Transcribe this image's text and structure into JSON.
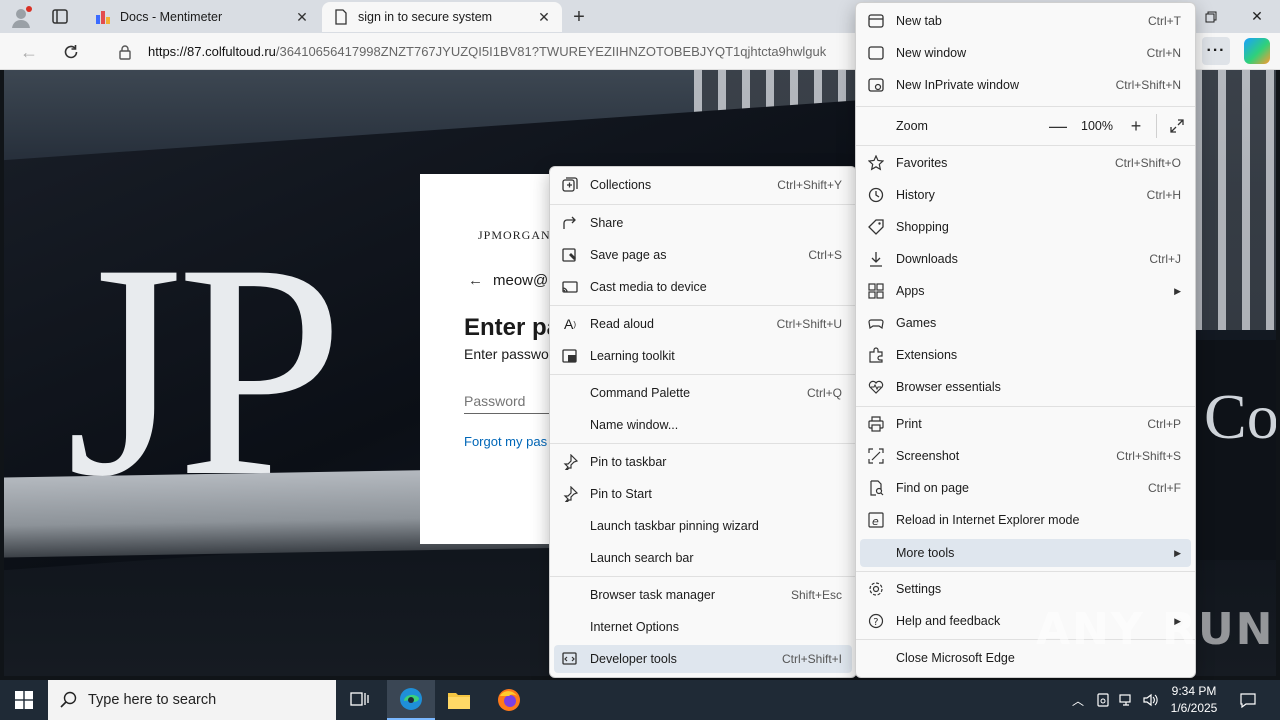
{
  "tabs": [
    {
      "title": "Docs - Mentimeter",
      "favicon": "mentimeter-icon",
      "active": false
    },
    {
      "title": "sign in to secure system",
      "favicon": "page-icon",
      "active": true
    }
  ],
  "address": {
    "url_host": "https://87.colfultoud.ru",
    "url_path": "/36410656417998ZNZT767JYUZQI5I1BV81?TWUREYEZIIHNZOTOBEBJYQT1qjhtcta9hwlguk"
  },
  "page": {
    "sign_text": "JP",
    "right_sign_text": "Co.",
    "login": {
      "brand": "JPMORGAN",
      "identity": "meow@",
      "heading": "Enter pa",
      "subheading": "Enter passwo",
      "password_placeholder": "Password",
      "forgot_link": "Forgot my pas"
    }
  },
  "more_tools_menu": {
    "items": [
      {
        "label": "Collections",
        "shortcut": "Ctrl+Shift+Y",
        "icon": "collections-icon"
      },
      {
        "label": "Share",
        "shortcut": "",
        "icon": "share-icon"
      },
      {
        "label": "Save page as",
        "shortcut": "Ctrl+S",
        "icon": "save-page-icon"
      },
      {
        "label": "Cast media to device",
        "shortcut": "",
        "icon": "cast-icon"
      },
      {
        "label": "Read aloud",
        "shortcut": "Ctrl+Shift+U",
        "icon": "read-aloud-icon"
      },
      {
        "label": "Learning toolkit",
        "shortcut": "",
        "icon": "learning-toolkit-icon"
      },
      {
        "label": "Command Palette",
        "shortcut": "Ctrl+Q",
        "icon": ""
      },
      {
        "label": "Name window...",
        "shortcut": "",
        "icon": ""
      },
      {
        "label": "Pin to taskbar",
        "shortcut": "",
        "icon": "pin-icon"
      },
      {
        "label": "Pin to Start",
        "shortcut": "",
        "icon": "pin-icon"
      },
      {
        "label": "Launch taskbar pinning wizard",
        "shortcut": "",
        "icon": ""
      },
      {
        "label": "Launch search bar",
        "shortcut": "",
        "icon": ""
      },
      {
        "label": "Browser task manager",
        "shortcut": "Shift+Esc",
        "icon": ""
      },
      {
        "label": "Internet Options",
        "shortcut": "",
        "icon": ""
      },
      {
        "label": "Developer tools",
        "shortcut": "Ctrl+Shift+I",
        "icon": "developer-tools-icon"
      }
    ]
  },
  "main_menu": {
    "new_tab": {
      "label": "New tab",
      "shortcut": "Ctrl+T"
    },
    "new_window": {
      "label": "New window",
      "shortcut": "Ctrl+N"
    },
    "new_inprivate": {
      "label": "New InPrivate window",
      "shortcut": "Ctrl+Shift+N"
    },
    "zoom": {
      "label": "Zoom",
      "value": "100%",
      "minus": "—",
      "plus": "+"
    },
    "favorites": {
      "label": "Favorites",
      "shortcut": "Ctrl+Shift+O"
    },
    "history": {
      "label": "History",
      "shortcut": "Ctrl+H"
    },
    "shopping": {
      "label": "Shopping",
      "shortcut": ""
    },
    "downloads": {
      "label": "Downloads",
      "shortcut": "Ctrl+J"
    },
    "apps": {
      "label": "Apps",
      "shortcut": ""
    },
    "games": {
      "label": "Games",
      "shortcut": ""
    },
    "extensions": {
      "label": "Extensions",
      "shortcut": ""
    },
    "browser_essentials": {
      "label": "Browser essentials",
      "shortcut": ""
    },
    "print": {
      "label": "Print",
      "shortcut": "Ctrl+P"
    },
    "screenshot": {
      "label": "Screenshot",
      "shortcut": "Ctrl+Shift+S"
    },
    "find": {
      "label": "Find on page",
      "shortcut": "Ctrl+F"
    },
    "ie_mode": {
      "label": "Reload in Internet Explorer mode",
      "shortcut": ""
    },
    "more_tools": {
      "label": "More tools",
      "shortcut": ""
    },
    "settings": {
      "label": "Settings",
      "shortcut": ""
    },
    "help": {
      "label": "Help and feedback",
      "shortcut": ""
    },
    "close_edge": {
      "label": "Close Microsoft Edge",
      "shortcut": ""
    }
  },
  "taskbar": {
    "search_placeholder": "Type here to search",
    "time": "9:34 PM",
    "date": "1/6/2025"
  },
  "watermark": "ANY RUN",
  "colors": {
    "highlight": "#dfe6ee",
    "accent": "#0067b8",
    "taskbar": "#1f2a36"
  }
}
